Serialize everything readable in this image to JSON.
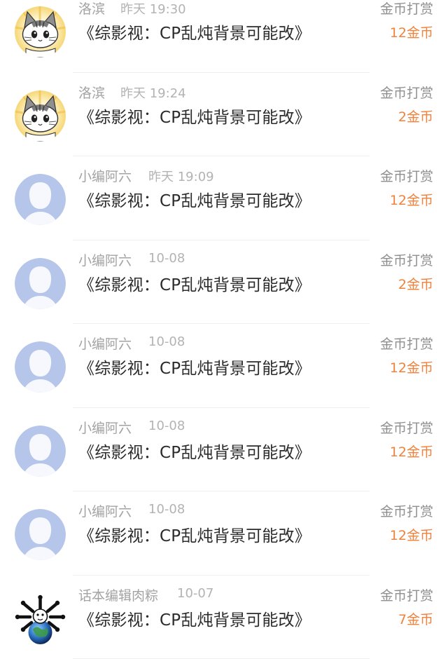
{
  "messages": [
    {
      "name": "洛滨",
      "time": "昨天 19:30",
      "title": "《综影视：CP乱炖背景可能改》",
      "action": "金币打赏",
      "amount": "12金币",
      "avatar_icon": "cat-avatar-icon"
    },
    {
      "name": "洛滨",
      "time": "昨天 19:24",
      "title": "《综影视：CP乱炖背景可能改》",
      "action": "金币打赏",
      "amount": "2金币",
      "avatar_icon": "cat-avatar-icon"
    },
    {
      "name": "小编阿六",
      "time": "昨天 19:09",
      "title": "《综影视：CP乱炖背景可能改》",
      "action": "金币打赏",
      "amount": "12金币",
      "avatar_icon": "default-user-avatar-icon"
    },
    {
      "name": "小编阿六",
      "time": "10-08",
      "title": "《综影视：CP乱炖背景可能改》",
      "action": "金币打赏",
      "amount": "2金币",
      "avatar_icon": "default-user-avatar-icon"
    },
    {
      "name": "小编阿六",
      "time": "10-08",
      "title": "《综影视：CP乱炖背景可能改》",
      "action": "金币打赏",
      "amount": "12金币",
      "avatar_icon": "default-user-avatar-icon"
    },
    {
      "name": "小编阿六",
      "time": "10-08",
      "title": "《综影视：CP乱炖背景可能改》",
      "action": "金币打赏",
      "amount": "12金币",
      "avatar_icon": "default-user-avatar-icon"
    },
    {
      "name": "小编阿六",
      "time": "10-08",
      "title": "《综影视：CP乱炖背景可能改》",
      "action": "金币打赏",
      "amount": "12金币",
      "avatar_icon": "default-user-avatar-icon"
    },
    {
      "name": "话本编辑肉粽",
      "time": "10-07",
      "title": "《综影视：CP乱炖背景可能改》",
      "action": "金币打赏",
      "amount": "7金币",
      "avatar_icon": "globe-character-avatar-icon"
    }
  ],
  "colors": {
    "amount": "#f0823c",
    "default_avatar_bg": "#b6c6ea"
  }
}
